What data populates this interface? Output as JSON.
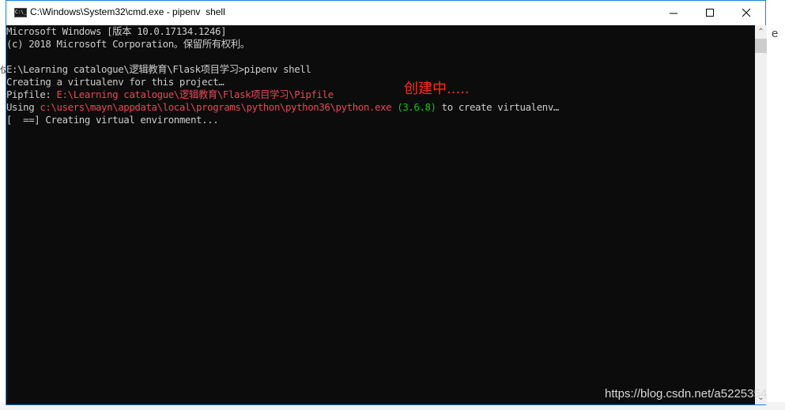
{
  "window": {
    "title": "C:\\Windows\\System32\\cmd.exe - pipenv  shell",
    "icon_label": "C:\\_",
    "controls": {
      "minimize": "—",
      "maximize": "☐",
      "close": "✕"
    }
  },
  "console": {
    "lines": [
      {
        "segments": [
          {
            "text": "Microsoft Windows [版本 10.0.17134.1246]",
            "color": "default"
          }
        ]
      },
      {
        "segments": [
          {
            "text": "(c) 2018 Microsoft Corporation。保留所有权利。",
            "color": "default"
          }
        ]
      },
      {
        "segments": [
          {
            "text": "",
            "color": "default"
          }
        ]
      },
      {
        "segments": [
          {
            "text": "E:\\Learning catalogue\\逻辑教育\\Flask项目学习>pipenv shell",
            "color": "default"
          }
        ]
      },
      {
        "segments": [
          {
            "text": "Creating a virtualenv for this project…",
            "color": "default"
          }
        ]
      },
      {
        "segments": [
          {
            "text": "Pipfile: ",
            "color": "default"
          },
          {
            "text": "E:\\Learning catalogue\\逻辑教育\\Flask项目学习\\Pipfile",
            "color": "red"
          }
        ]
      },
      {
        "segments": [
          {
            "text": "Using ",
            "color": "default"
          },
          {
            "text": "c:\\users\\mayn\\appdata\\local\\programs\\python\\python36\\python.exe",
            "color": "red"
          },
          {
            "text": " (3.6.8)",
            "color": "green"
          },
          {
            "text": " to create virtualenv…",
            "color": "default"
          }
        ]
      },
      {
        "segments": [
          {
            "text": "[  ==] Creating virtual environment...",
            "color": "default"
          }
        ]
      }
    ],
    "annotation": "创建中....."
  },
  "scrollbar": {
    "up": "⌃",
    "down": "⌄"
  },
  "watermark": "https://blog.csdn.net/a5225354",
  "background_fragments": {
    "right_top": "e",
    "left_row": "仗"
  },
  "colors": {
    "default": "#cccccc",
    "red": "#e74856",
    "green": "#16c60c",
    "annotation": "#ff2a1a",
    "window_border": "#1883d7"
  }
}
